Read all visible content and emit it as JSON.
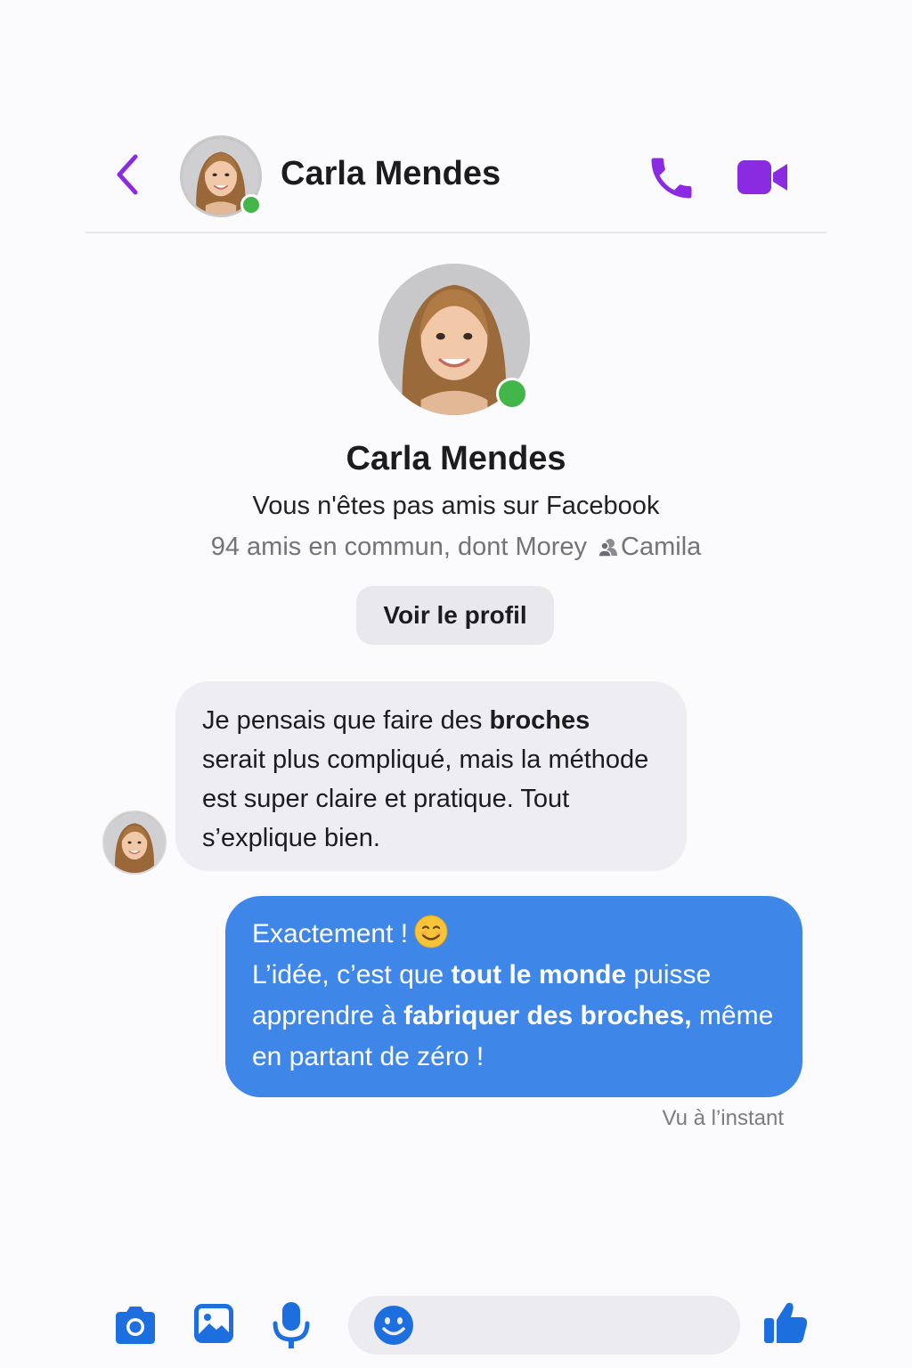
{
  "colors": {
    "accent_purple": "#8a2be2",
    "online_green": "#43b649",
    "outgoing_bubble": "#3e86e8",
    "incoming_bubble": "#eeedf1",
    "toolbar_blue": "#1d6fe0"
  },
  "header": {
    "back_icon": "chevron-left-icon",
    "contact_name": "Carla Mendes",
    "call_icon": "phone-icon",
    "video_icon": "video-camera-icon"
  },
  "profile": {
    "name": "Carla Mendes",
    "relation": "Vous n'êtes pas amis sur Facebook",
    "mutual_prefix": "94 amis en commun, dont Morey",
    "mutual_icon": "mutual-friend-icon",
    "mutual_suffix": "Camila",
    "view_profile_label": "Voir le profil"
  },
  "messages": {
    "incoming": {
      "part1": "Je pensais que faire des ",
      "bold1": "broches",
      "part2": " serait plus compliqué, mais la méthode est super claire et pratique. Tout s’explique bien."
    },
    "outgoing": {
      "line1": "Exactement !",
      "emoji": "smiling-face-icon",
      "part1": "L’idée, c’est que ",
      "bold1": "tout le monde",
      "part2": " puisse apprendre à ",
      "bold2": "fabriquer des broches,",
      "part3": " même en partant de zéro !"
    },
    "seen_status": "Vu à l’instant"
  },
  "composer": {
    "camera_icon": "camera-icon",
    "gallery_icon": "image-icon",
    "mic_icon": "microphone-icon",
    "emoji_icon": "smiley-icon",
    "input_value": "",
    "like_icon": "thumbs-up-icon"
  }
}
